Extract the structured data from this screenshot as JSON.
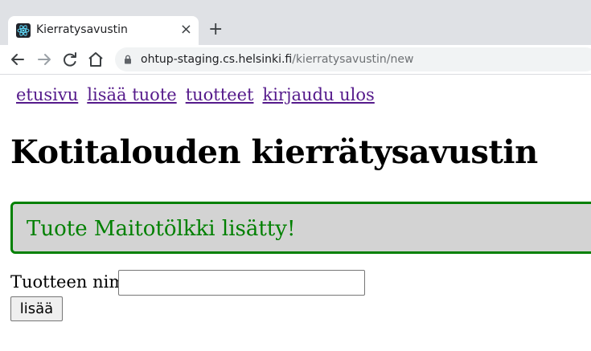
{
  "browser": {
    "tab_title": "Kierratysavustin",
    "tab_favicon": "react-icon",
    "url_host": "ohtup-staging.cs.helsinki.fi",
    "url_path": "/kierratysavustin/new"
  },
  "nav": {
    "links": [
      "etusivu",
      "lisää tuote",
      "tuotteet",
      "kirjaudu ulos"
    ]
  },
  "main": {
    "title": "Kotitalouden kierrätysavustin",
    "notification": "Tuote Maitotölkki lisätty!",
    "form": {
      "name_label": "Tuotteen nimi",
      "name_value": "",
      "submit_label": "lisää"
    }
  },
  "colors": {
    "notification_text": "#008000",
    "notification_bg": "#d3d3d3",
    "link_visited": "#551a8b"
  }
}
